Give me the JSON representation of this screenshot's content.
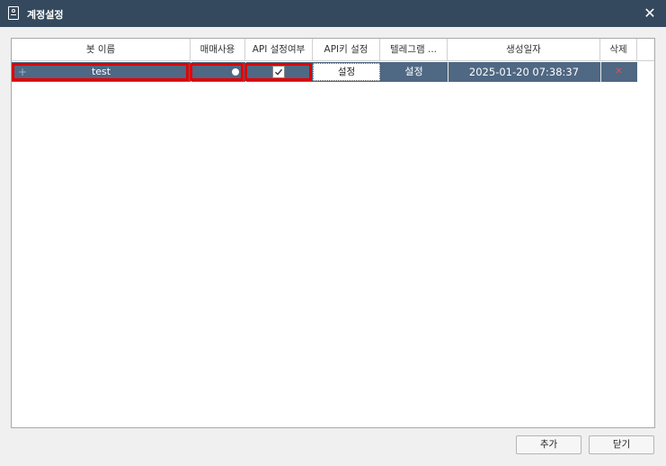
{
  "window": {
    "title": "계정설정",
    "icon": "account-card-icon",
    "close_glyph": "✕"
  },
  "table": {
    "columns": [
      "봇 이름",
      "매매사용",
      "API 설정여부",
      "API키 설정",
      "텔레그램 ...",
      "생성일자",
      "삭제"
    ],
    "rows": [
      {
        "expand_glyph": "+",
        "bot_name": "test",
        "trading_enabled": true,
        "api_configured": true,
        "api_key_action": "설정",
        "telegram_action": "설정",
        "created_at": "2025-01-20 07:38:37",
        "delete_glyph": "✕"
      }
    ]
  },
  "footer": {
    "add_label": "추가",
    "close_label": "닫기"
  },
  "colors": {
    "titlebar": "#34495e",
    "selected_row": "#4f6883",
    "highlight": "#e10000",
    "delete": "#d85454"
  }
}
